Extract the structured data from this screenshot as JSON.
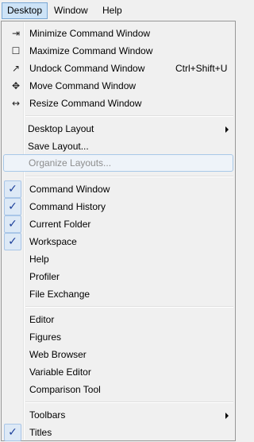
{
  "menubar": {
    "items": [
      "Desktop",
      "Window",
      "Help"
    ]
  },
  "window_section": {
    "minimize": {
      "label": "Minimize Command Window",
      "icon": "minimize-icon"
    },
    "maximize": {
      "label": "Maximize Command Window",
      "icon": "maximize-icon"
    },
    "undock": {
      "label": "Undock Command Window",
      "shortcut": "Ctrl+Shift+U",
      "icon": "undock-icon"
    },
    "move": {
      "label": "Move Command Window",
      "icon": "move-icon"
    },
    "resize": {
      "label": "Resize Command Window",
      "icon": "resize-icon"
    }
  },
  "layout_section": {
    "desktop_layout": "Desktop Layout",
    "save_layout": "Save Layout...",
    "organize_layouts": "Organize Layouts..."
  },
  "tools_section": {
    "command_window": "Command Window",
    "command_history": "Command History",
    "current_folder": "Current Folder",
    "workspace": "Workspace",
    "help": "Help",
    "profiler": "Profiler",
    "file_exchange": "File Exchange"
  },
  "editors_section": {
    "editor": "Editor",
    "figures": "Figures",
    "web_browser": "Web Browser",
    "variable_editor": "Variable Editor",
    "comparison_tool": "Comparison Tool"
  },
  "bottom_section": {
    "toolbars": "Toolbars",
    "titles": "Titles"
  },
  "check_mark": "✓"
}
